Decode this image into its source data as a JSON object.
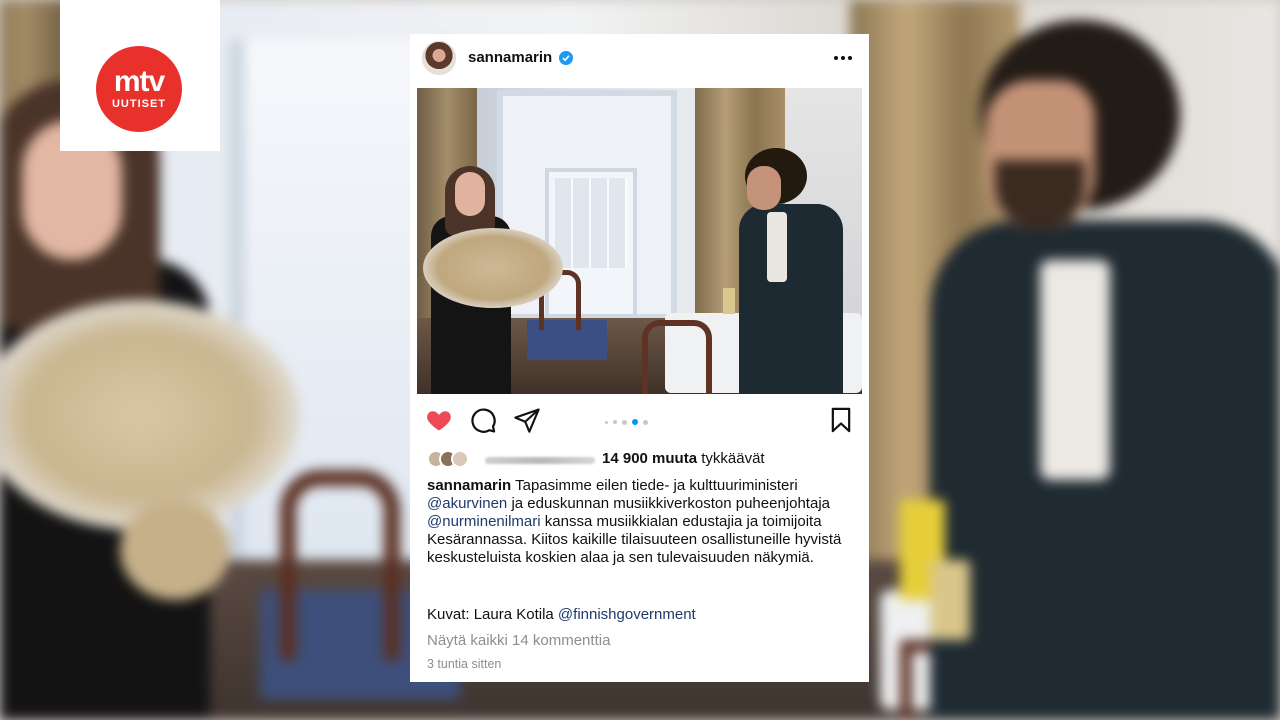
{
  "logo": {
    "brand": "mtv",
    "sub": "UUTISET",
    "color": "#e8312b"
  },
  "post": {
    "username": "sannamarin",
    "verified": true,
    "more_icon": "more-horizontal-icon",
    "actions": {
      "like_icon": "heart-filled-icon",
      "comment_icon": "comment-icon",
      "share_icon": "send-icon",
      "save_icon": "bookmark-icon",
      "carousel_total": 5,
      "carousel_active": 4
    },
    "likes": {
      "count_text": "14 900 muuta",
      "suffix": "tykkäävät"
    },
    "caption": {
      "user": "sannamarin",
      "part1": "Tapasimme eilen tiede- ja kulttuuriministeri",
      "mention1": "@akurvinen",
      "part2": "ja eduskunnan musiikkiverkoston puheenjohtaja",
      "mention2": "@nurminenilmari",
      "part3": "kanssa musiikkialan edustajia ja toimijoita Kesärannassa. Kiitos kaikille tilaisuuteen osallistuneille hyvistä keskusteluista koskien alaa ja sen tulevaisuuden näkymiä."
    },
    "credits": {
      "text": "Kuvat: Laura Kotila",
      "mention": "@finnishgovernment"
    },
    "view_comments": "Näytä kaikki 14 kommenttia",
    "timestamp": "3 tuntia sitten",
    "colors": {
      "heart": "#ed4956",
      "mention": "#1e3a6b",
      "active_dot": "#0095f6"
    }
  }
}
